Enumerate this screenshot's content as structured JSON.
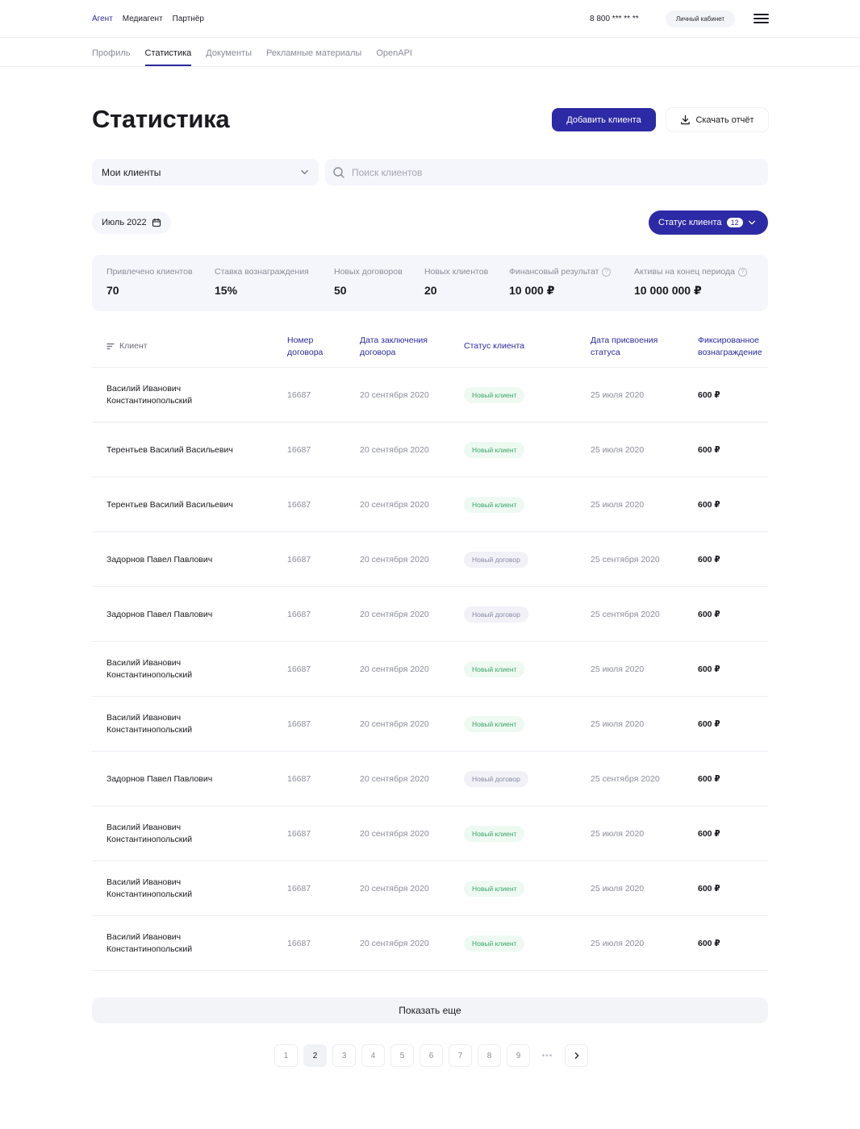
{
  "topbar": {
    "roles": [
      "Агент",
      "Медиагент",
      "Партнёр"
    ],
    "phone": "8 800 *** ** **",
    "cabinet_label": "Личный кабинет",
    "menu_icon": "menu-icon"
  },
  "subnav": {
    "tabs": [
      "Профиль",
      "Статистика",
      "Документы",
      "Рекламные материалы",
      "OpenAPI"
    ],
    "active_tab": "Статистика"
  },
  "page": {
    "title": "Статистика",
    "add_client_label": "Добавить клиента",
    "download_label": "Скачать отчёт"
  },
  "filters": {
    "select_value": "Мои клиенты",
    "search_placeholder": "Поиск клиентов",
    "month": "Июль 2022",
    "status_label": "Статус клиента",
    "status_count": "12"
  },
  "stats": [
    {
      "label": "Привлечено клиентов",
      "value": "70"
    },
    {
      "label": "Ставка вознаграждения",
      "value": "15%"
    },
    {
      "label": "Новых договоров",
      "value": "50"
    },
    {
      "label": "Новых клиентов",
      "value": "20"
    },
    {
      "label": "Финансовый результат",
      "value": "10 000 ₽"
    },
    {
      "label": "Активы на конец периода",
      "value": "10 000 000 ₽"
    }
  ],
  "table": {
    "headers": {
      "client": "Клиент",
      "contract_number": "Номер договора",
      "contract_date": "Дата заключения договора",
      "status": "Статус клиента",
      "status_date": "Дата присвоения статуса",
      "fee": "Фиксированное вознаграждение"
    },
    "rows": [
      {
        "name": "Василий Иванович Константинопольский",
        "number": "16687",
        "date": "20 сентября 2020",
        "status": "Новый клиент",
        "status_type": "new-client",
        "status_date": "25 июля 2020",
        "fee": "600 ₽"
      },
      {
        "name": "Терентьев Василий Васильевич",
        "number": "16687",
        "date": "20 сентября 2020",
        "status": "Новый клиент",
        "status_type": "new-client",
        "status_date": "25 июля 2020",
        "fee": "600 ₽"
      },
      {
        "name": "Терентьев Василий Васильевич",
        "number": "16687",
        "date": "20 сентября 2020",
        "status": "Новый клиент",
        "status_type": "new-client",
        "status_date": "25 июля 2020",
        "fee": "600 ₽"
      },
      {
        "name": "Задорнов Павел Павлович",
        "number": "16687",
        "date": "20 сентября 2020",
        "status": "Новый договор",
        "status_type": "new-contract",
        "status_date": "25 сентября 2020",
        "fee": "600 ₽"
      },
      {
        "name": "Задорнов Павел Павлович",
        "number": "16687",
        "date": "20 сентября 2020",
        "status": "Новый договор",
        "status_type": "new-contract",
        "status_date": "25 сентября 2020",
        "fee": "600 ₽"
      },
      {
        "name": "Василий Иванович Константинопольский",
        "number": "16687",
        "date": "20 сентября 2020",
        "status": "Новый клиент",
        "status_type": "new-client",
        "status_date": "25 июля 2020",
        "fee": "600 ₽"
      },
      {
        "name": "Василий Иванович Константинопольский",
        "number": "16687",
        "date": "20 сентября 2020",
        "status": "Новый клиент",
        "status_type": "new-client",
        "status_date": "25 июля 2020",
        "fee": "600 ₽"
      },
      {
        "name": "Задорнов Павел Павлович",
        "number": "16687",
        "date": "20 сентября 2020",
        "status": "Новый договор",
        "status_type": "new-contract",
        "status_date": "25 сентября 2020",
        "fee": "600 ₽"
      },
      {
        "name": "Василий Иванович Константинопольский",
        "number": "16687",
        "date": "20 сентября 2020",
        "status": "Новый клиент",
        "status_type": "new-client",
        "status_date": "25 июля 2020",
        "fee": "600 ₽"
      },
      {
        "name": "Василий Иванович Константинопольский",
        "number": "16687",
        "date": "20 сентября 2020",
        "status": "Новый клиент",
        "status_type": "new-client",
        "status_date": "25 июля 2020",
        "fee": "600 ₽"
      },
      {
        "name": "Василий Иванович Константинопольский",
        "number": "16687",
        "date": "20 сентября 2020",
        "status": "Новый клиент",
        "status_type": "new-client",
        "status_date": "25 июля 2020",
        "fee": "600 ₽"
      }
    ]
  },
  "show_more_label": "Показать еще",
  "pagination": {
    "pages": [
      "1",
      "2",
      "3",
      "4",
      "5",
      "6",
      "7",
      "8",
      "9"
    ],
    "current": "2",
    "ellipsis": "•••",
    "next_icon": "chevron-right-icon"
  },
  "colors": {
    "accent": "#2d2aa6",
    "new_client": "#3aa66a",
    "new_contract": "#8a8ba6"
  }
}
